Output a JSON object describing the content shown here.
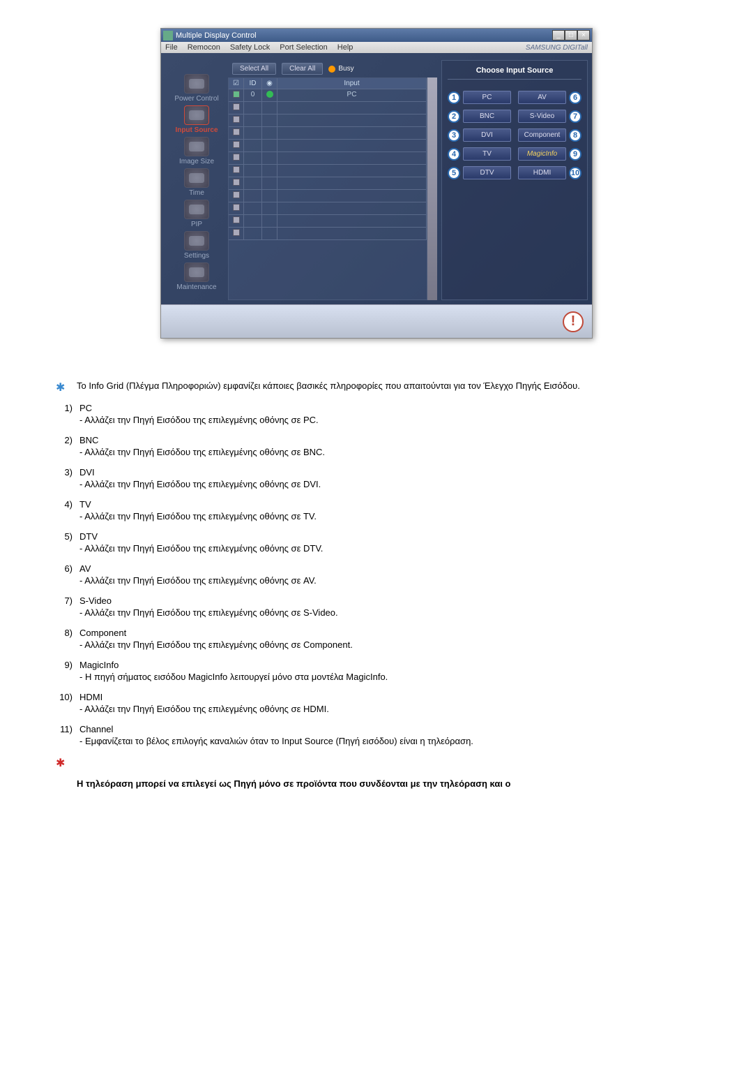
{
  "window": {
    "title": "Multiple Display Control",
    "menus": [
      "File",
      "Remocon",
      "Safety Lock",
      "Port Selection",
      "Help"
    ],
    "brand": "SAMSUNG DIGITall"
  },
  "sidebar": {
    "items": [
      {
        "label": "Power Control",
        "name": "power-control"
      },
      {
        "label": "Input Source",
        "name": "input-source"
      },
      {
        "label": "Image Size",
        "name": "image-size"
      },
      {
        "label": "Time",
        "name": "time"
      },
      {
        "label": "PIP",
        "name": "pip"
      },
      {
        "label": "Settings",
        "name": "settings"
      },
      {
        "label": "Maintenance",
        "name": "maintenance"
      }
    ],
    "activeIndex": 1
  },
  "toolbar": {
    "selectAll": "Select All",
    "clearAll": "Clear All",
    "busy": "Busy"
  },
  "grid": {
    "headers": {
      "id": "ID",
      "input": "Input"
    },
    "rows": [
      {
        "checked": true,
        "id": "0",
        "status": "green",
        "input": "PC"
      },
      {
        "checked": false,
        "id": "",
        "status": "",
        "input": ""
      },
      {
        "checked": false,
        "id": "",
        "status": "",
        "input": ""
      },
      {
        "checked": false,
        "id": "",
        "status": "",
        "input": ""
      },
      {
        "checked": false,
        "id": "",
        "status": "",
        "input": ""
      },
      {
        "checked": false,
        "id": "",
        "status": "",
        "input": ""
      },
      {
        "checked": false,
        "id": "",
        "status": "",
        "input": ""
      },
      {
        "checked": false,
        "id": "",
        "status": "",
        "input": ""
      },
      {
        "checked": false,
        "id": "",
        "status": "",
        "input": ""
      },
      {
        "checked": false,
        "id": "",
        "status": "",
        "input": ""
      },
      {
        "checked": false,
        "id": "",
        "status": "",
        "input": ""
      },
      {
        "checked": false,
        "id": "",
        "status": "",
        "input": ""
      }
    ]
  },
  "rightPanel": {
    "title": "Choose Input Source",
    "sources": [
      {
        "num": "1",
        "label": "PC"
      },
      {
        "num": "6",
        "label": "AV"
      },
      {
        "num": "2",
        "label": "BNC"
      },
      {
        "num": "7",
        "label": "S-Video"
      },
      {
        "num": "3",
        "label": "DVI"
      },
      {
        "num": "8",
        "label": "Component"
      },
      {
        "num": "4",
        "label": "TV"
      },
      {
        "num": "9",
        "label": "MagicInfo"
      },
      {
        "num": "5",
        "label": "DTV"
      },
      {
        "num": "10",
        "label": "HDMI"
      }
    ]
  },
  "notes": {
    "intro": "Το Info Grid (Πλέγμα Πληροφοριών) εμφανίζει κάποιες βασικές πληροφορίες που απαιτούνται για τον Έλεγχο Πηγής Εισόδου.",
    "items": [
      {
        "num": "1)",
        "title": "PC",
        "desc": "- Αλλάζει την Πηγή Εισόδου της επιλεγμένης οθόνης σε PC."
      },
      {
        "num": "2)",
        "title": "BNC",
        "desc": "- Αλλάζει την Πηγή Εισόδου της επιλεγμένης οθόνης σε BNC."
      },
      {
        "num": "3)",
        "title": "DVI",
        "desc": "- Αλλάζει την Πηγή Εισόδου της επιλεγμένης οθόνης σε DVI."
      },
      {
        "num": "4)",
        "title": "TV",
        "desc": "- Αλλάζει την Πηγή Εισόδου της επιλεγμένης οθόνης σε TV."
      },
      {
        "num": "5)",
        "title": "DTV",
        "desc": "- Αλλάζει την Πηγή Εισόδου της επιλεγμένης οθόνης σε DTV."
      },
      {
        "num": "6)",
        "title": "AV",
        "desc": "- Αλλάζει την Πηγή Εισόδου της επιλεγμένης οθόνης σε AV."
      },
      {
        "num": "7)",
        "title": "S-Video",
        "desc": "- Αλλάζει την Πηγή Εισόδου της επιλεγμένης οθόνης σε S-Video."
      },
      {
        "num": "8)",
        "title": "Component",
        "desc": "- Αλλάζει την Πηγή Εισόδου της επιλεγμένης οθόνης σε Component."
      },
      {
        "num": "9)",
        "title": "MagicInfo",
        "desc": "- Η πηγή σήματος εισόδου MagicInfo λειτουργεί μόνο στα μοντέλα MagicInfo."
      },
      {
        "num": "10)",
        "title": "HDMI",
        "desc": "- Αλλάζει την Πηγή Εισόδου της επιλεγμένης οθόνης σε HDMI."
      },
      {
        "num": "11)",
        "title": "Channel",
        "desc": "- Εμφανίζεται το βέλος επιλογής καναλιών όταν το Input Source (Πηγή εισόδου) είναι η τηλεόραση."
      }
    ],
    "bold": "Η τηλεόραση μπορεί να επιλεγεί ως Πηγή μόνο σε προϊόντα που συνδέονται με την τηλεόραση και ο"
  }
}
